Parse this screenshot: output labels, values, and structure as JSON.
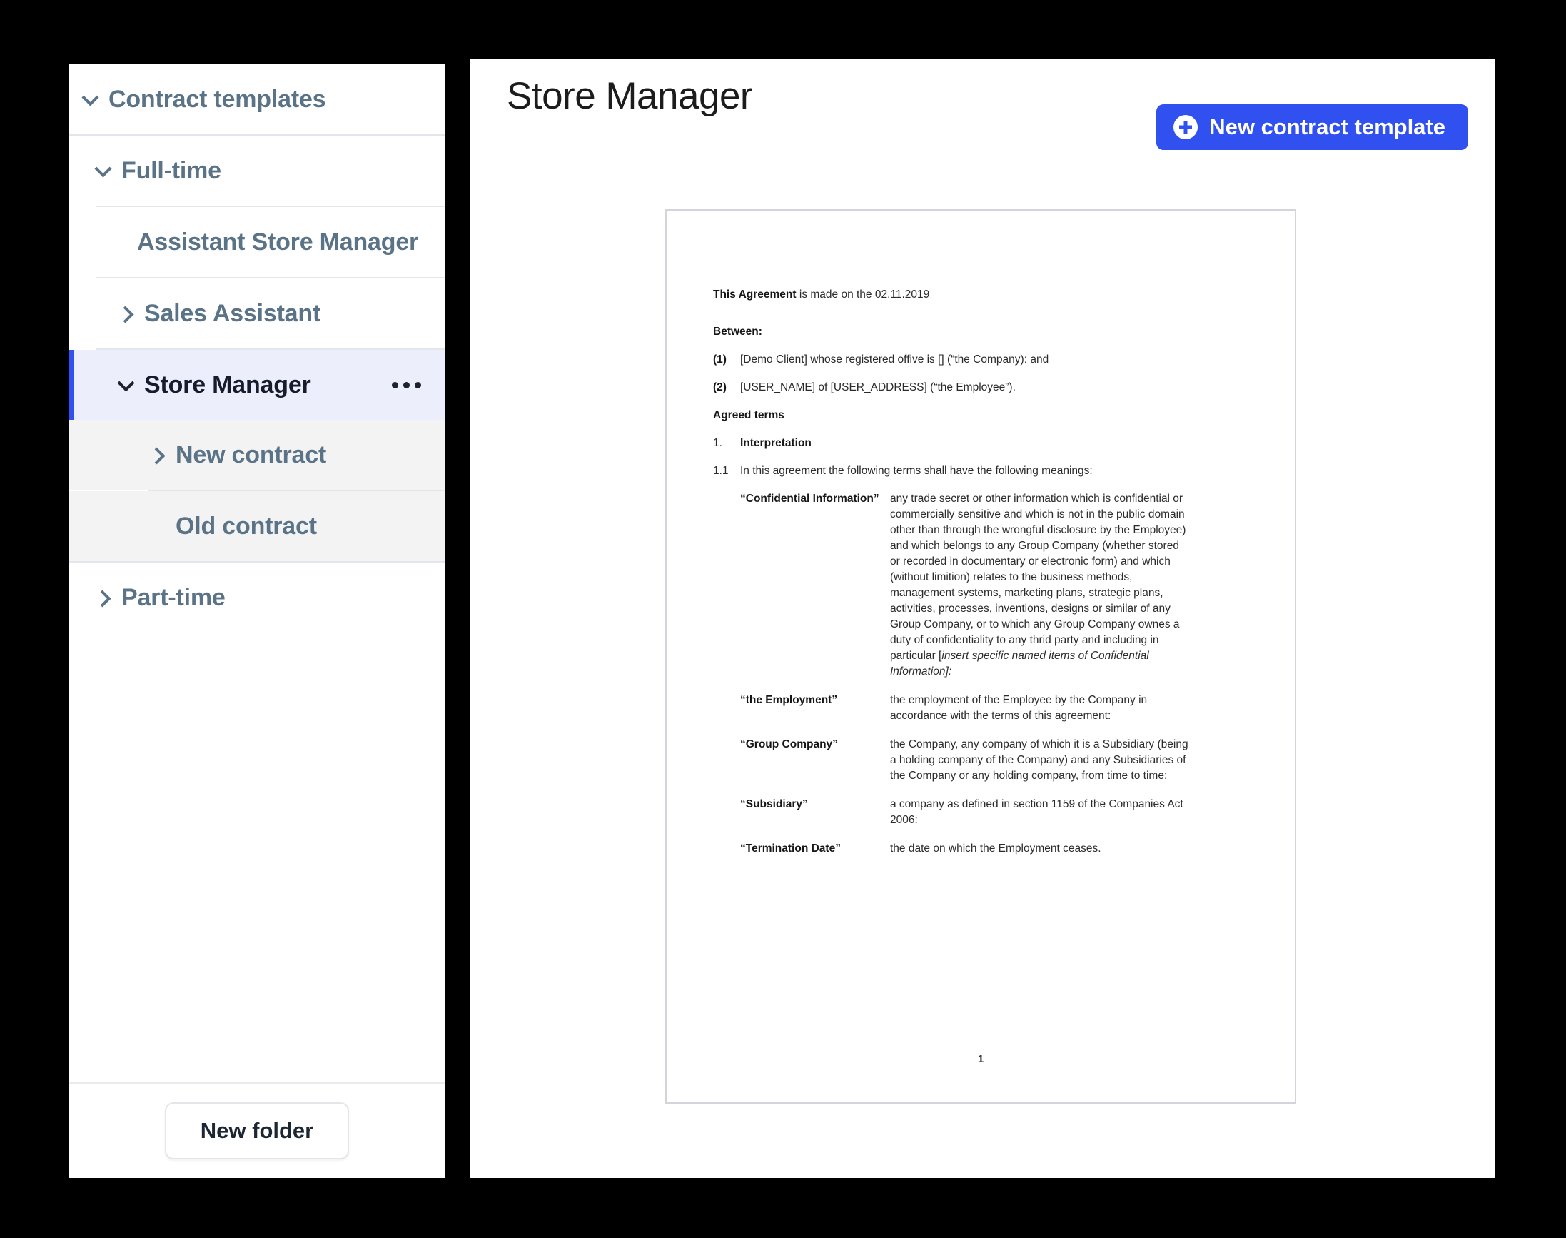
{
  "sidebar": {
    "tree": [
      {
        "label": "Contract templates",
        "level": 0,
        "chevron": "down",
        "state": "expanded"
      },
      {
        "label": "Full-time",
        "level": 1,
        "chevron": "down",
        "state": "expanded"
      },
      {
        "label": "Assistant Store Manager",
        "level": 2,
        "chevron": "none",
        "state": "leaf"
      },
      {
        "label": "Sales Assistant",
        "level": 2,
        "chevron": "right",
        "state": "collapsed"
      },
      {
        "label": "Store Manager",
        "level": 2,
        "chevron": "down",
        "state": "selected",
        "menu": "..."
      },
      {
        "label": "New contract",
        "level": 3,
        "chevron": "right",
        "state": "collapsed"
      },
      {
        "label": "Old contract",
        "level": 3,
        "chevron": "none",
        "state": "leaf"
      },
      {
        "label": "Part-time",
        "level": 1,
        "chevron": "right",
        "state": "collapsed"
      }
    ],
    "footer": {
      "new_folder_label": "New folder"
    }
  },
  "main": {
    "title": "Store Manager",
    "new_template_button": "New contract template",
    "accent_color": "#3050f0",
    "selected_row_bg": "#eceefc"
  },
  "document": {
    "agreement_lead_bold": "This Agreement",
    "agreement_lead_rest": " is made on the  02.11.2019",
    "between_heading": "Between:",
    "parties": [
      {
        "num": "(1)",
        "text": "[Demo Client] whose registered offive is [] (“the Company): and"
      },
      {
        "num": "(2)",
        "text": "[USER_NAME] of [USER_ADDRESS] (“the Employee”)."
      }
    ],
    "agreed_terms_heading": "Agreed terms",
    "clause_1_num": "1.",
    "clause_1_title": "Interpretation",
    "clause_1_1_num": "1.1",
    "clause_1_1_text": "In this agreement the following terms shall have the following meanings:",
    "definitions": [
      {
        "term": "“Confidential Information”",
        "definition": "any trade secret or other information which is confidential or commercially sensitive and which is not in the public domain other than through the wrongful disclosure by the Employee) and which belongs to any Group Company (whether stored or recorded in documentary or electronic form) and which (without limition) relates to the business methods, management systems, marketing plans, strategic plans, activities, processes, inventions, designs or similar of any Group Company, or to which any Group Company ownes a duty of confidentiality to any thrid party and including  in particular [",
        "definition_italic": "insert specific named items of Confidential Information]:"
      },
      {
        "term": "“the Employment”",
        "definition": "the employment of the Employee by the Company in accordance with the terms of this agreement:"
      },
      {
        "term": "“Group Company”",
        "definition": "the Company, any company of which it is a Subsidiary (being a holding company of the Company) and any Subsidiaries of the Company or any holding company, from time to time:"
      },
      {
        "term": "“Subsidiary”",
        "definition": "a company as defined in section 1159 of the Companies Act 2006:"
      },
      {
        "term": "“Termination Date”",
        "definition": "the date on which the Employment ceases."
      }
    ],
    "page_number": "1"
  }
}
